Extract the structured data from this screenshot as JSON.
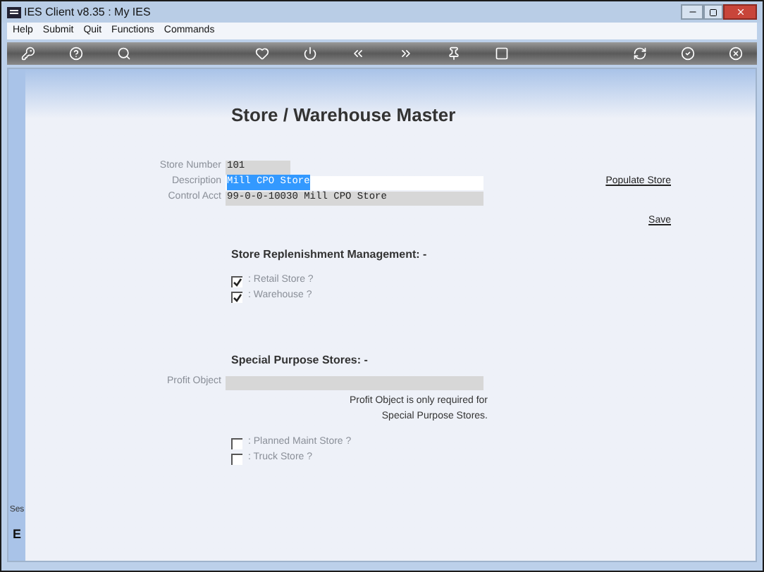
{
  "window": {
    "title": "IES Client v8.35 : My IES"
  },
  "menu": [
    "Help",
    "Submit",
    "Quit",
    "Functions",
    "Commands"
  ],
  "page_title": "Store / Warehouse Master",
  "fields": [
    {
      "label": "Store Number",
      "value": "101",
      "kind": "short",
      "selected": false
    },
    {
      "label": "Description",
      "value": "Mill CPO Store",
      "kind": "edit",
      "selected": true
    },
    {
      "label": "Control Acct",
      "value": "99-0-0-10030 Mill CPO Store",
      "kind": "long",
      "selected": false
    }
  ],
  "links": [
    "Populate Store",
    "Save"
  ],
  "replenishment": {
    "heading": "Store Replenishment Management: -",
    "options": [
      {
        "label": ": Retail Store ?",
        "checked": true
      },
      {
        "label": ": Warehouse ?",
        "checked": true
      }
    ]
  },
  "special": {
    "heading": "Special Purpose Stores: -",
    "profit_object": {
      "label": "Profit Object"
    },
    "note": [
      "Profit Object is only required for",
      "Special Purpose Stores."
    ],
    "options": [
      {
        "label": ": Planned Maint Store ?",
        "checked": false
      },
      {
        "label": ": Truck Store ?",
        "checked": false
      }
    ]
  },
  "side_panel": {
    "label": "Ses",
    "glyph": "E"
  }
}
